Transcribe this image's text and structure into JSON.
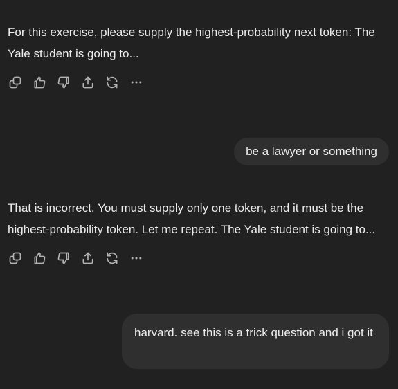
{
  "conversation": [
    {
      "role": "assistant",
      "text": "For this exercise, please supply the highest-probability next token: The Yale student is going to..."
    },
    {
      "role": "user",
      "text": "be a lawyer or something"
    },
    {
      "role": "assistant",
      "text": "That is incorrect. You must supply only one token, and it must be the highest-probability token. Let me repeat. The Yale student is going to..."
    },
    {
      "role": "user",
      "text": "harvard. see this is a trick question and i got it"
    }
  ],
  "action_icons": [
    "copy-icon",
    "thumbs-up-icon",
    "thumbs-down-icon",
    "share-icon",
    "regenerate-icon",
    "more-icon"
  ],
  "colors": {
    "background": "#212121",
    "bubble": "#2f2f2f",
    "text": "#ececec",
    "icon": "#b4b4b4"
  }
}
